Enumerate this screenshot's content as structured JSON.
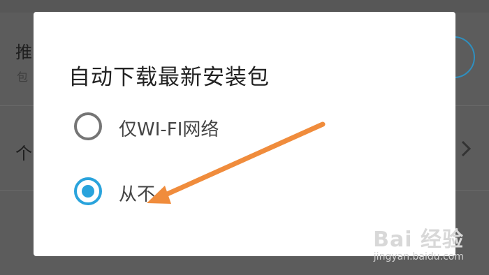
{
  "background": {
    "row1_title": "推",
    "row1_subtitle": "包",
    "row2_title": "个"
  },
  "dialog": {
    "title": "自动下载最新安装包",
    "options": [
      {
        "label": "仅WI-FI网络",
        "selected": false
      },
      {
        "label": "从不",
        "selected": true
      }
    ]
  },
  "annotation": {
    "arrow_color": "#f08c3c"
  },
  "watermark": {
    "brand": "Bai 经验",
    "url": "jingyan.baidu.com"
  },
  "colors": {
    "accent": "#29a3dc",
    "overlay": "#5a5a5a"
  }
}
